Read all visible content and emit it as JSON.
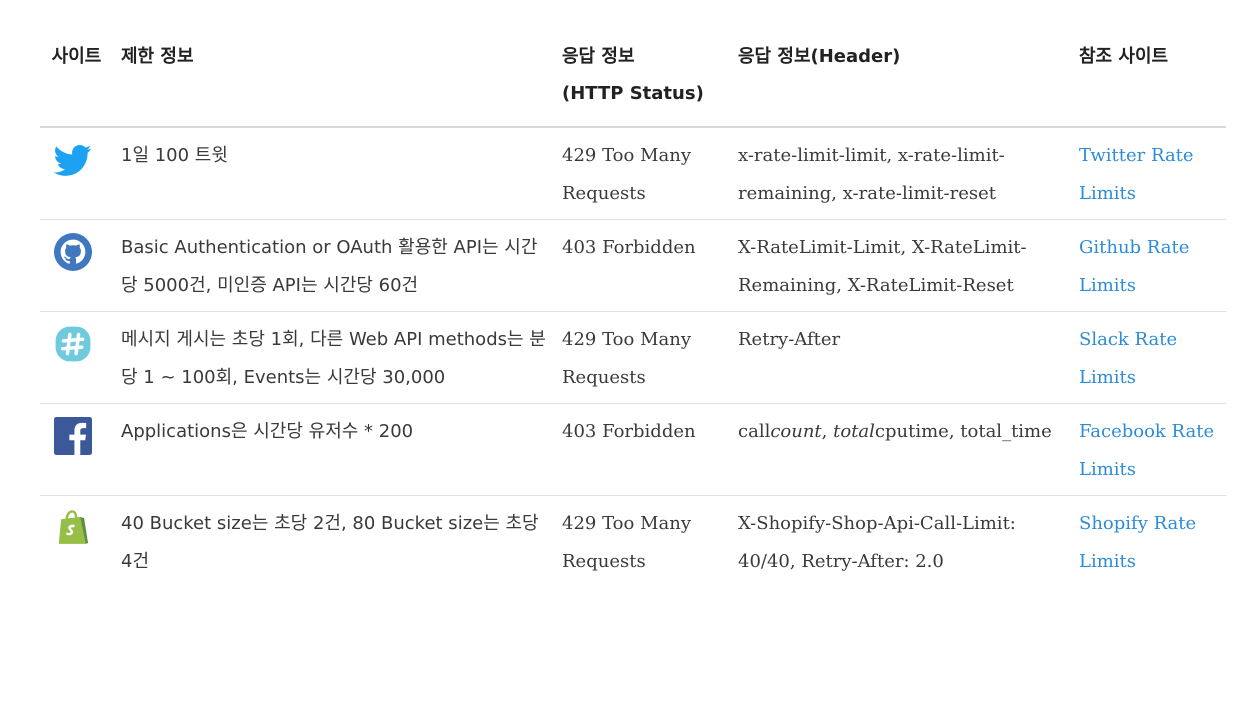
{
  "headers": {
    "site": "사이트",
    "limit": "제한 정보",
    "status_line1": "응답 정보",
    "status_line2": "(HTTP Status)",
    "header": "응답 정보(Header)",
    "reference": "참조 사이트"
  },
  "rows": [
    {
      "logo_icon": "twitter-bird-icon",
      "limit": "1일 100 트윗",
      "status": "429 Too Many Requests",
      "header": "x-rate-limit-limit, x-rate-limit-remaining, x-rate-limit-reset",
      "reference": "Twitter Rate Limits"
    },
    {
      "logo_icon": "github-octocat-icon",
      "limit": "Basic Authentication or OAuth 활용한 API는 시간당 5000건, 미인증 API는 시간당 60건",
      "status": "403 Forbidden",
      "header": "X-RateLimit-Limit, X-RateLimit-Remaining, X-RateLimit-Reset",
      "reference": "Github Rate Limits"
    },
    {
      "logo_icon": "slack-hash-icon",
      "limit": "메시지 게시는 초당 1회, 다른 Web API methods는 분당 1 ~ 100회, Events는 시간당 30,000",
      "status": "429 Too Many Requests",
      "header": "Retry-After",
      "reference": "Slack Rate Limits"
    },
    {
      "logo_icon": "facebook-f-icon",
      "limit": "Applications은 시간당 유저수 * 200",
      "status": "403 Forbidden",
      "header_parts": [
        "call",
        "count",
        ", ",
        "total",
        "cputime, total_time"
      ],
      "reference": "Facebook Rate Limits"
    },
    {
      "logo_icon": "shopify-bag-icon",
      "limit": "40 Bucket size는 초당 2건, 80 Bucket size는 초당 4건",
      "status": "429 Too Many Requests",
      "header": "X-Shopify-Shop-Api-Call-Limit: 40/40, Retry-After: 2.0",
      "reference": "Shopify Rate Limits"
    }
  ],
  "colors": {
    "link": "#2d8cd6",
    "twitter": "#1da1f2",
    "github": "#4078c0",
    "slack": "#6ecadc",
    "facebook": "#3b5998",
    "shopify": "#95bf47"
  }
}
